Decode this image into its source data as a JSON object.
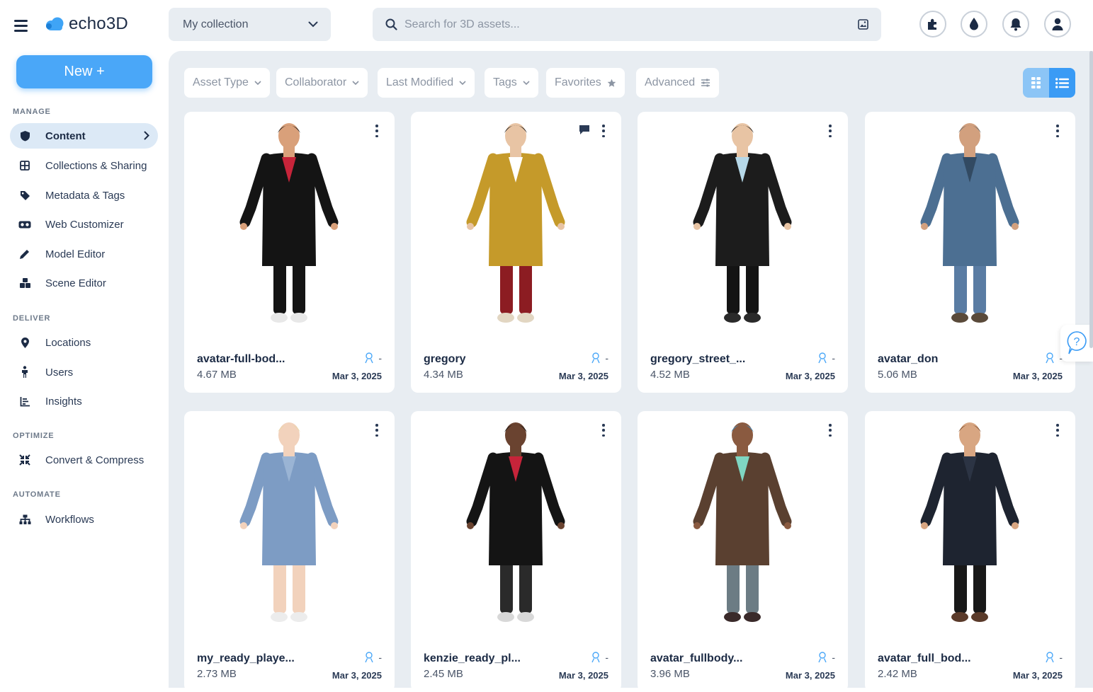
{
  "app": {
    "logo_text": "echo3D"
  },
  "header": {
    "collection": {
      "value": "My collection"
    },
    "search": {
      "placeholder": "Search for 3D assets..."
    },
    "icons": [
      "puzzle-icon",
      "drop-icon",
      "bell-icon",
      "user-icon"
    ]
  },
  "sidebar": {
    "new_button": "New +",
    "sections": [
      {
        "label": "MANAGE",
        "items": [
          {
            "label": "Content",
            "icon": "shield-icon",
            "active": true
          },
          {
            "label": "Collections & Sharing",
            "icon": "grid-icon"
          },
          {
            "label": "Metadata & Tags",
            "icon": "tag-icon"
          },
          {
            "label": "Web Customizer",
            "icon": "vr-glasses-icon"
          },
          {
            "label": "Model Editor",
            "icon": "pencil-icon"
          },
          {
            "label": "Scene Editor",
            "icon": "cubes-icon"
          }
        ]
      },
      {
        "label": "DELIVER",
        "items": [
          {
            "label": "Locations",
            "icon": "location-pin-icon"
          },
          {
            "label": "Users",
            "icon": "person-icon"
          },
          {
            "label": "Insights",
            "icon": "bar-chart-icon"
          }
        ]
      },
      {
        "label": "OPTIMIZE",
        "items": [
          {
            "label": "Convert & Compress",
            "icon": "compress-icon"
          }
        ]
      },
      {
        "label": "AUTOMATE",
        "items": [
          {
            "label": "Workflows",
            "icon": "sitemap-icon"
          }
        ]
      }
    ]
  },
  "filters": [
    {
      "label": "Asset Type",
      "icon": "chevron-down-icon"
    },
    {
      "label": "Collaborator",
      "icon": "chevron-down-icon"
    },
    {
      "label": "Last Modified",
      "icon": "chevron-down-icon"
    },
    {
      "label": "Tags",
      "icon": "chevron-down-icon"
    },
    {
      "label": "Favorites",
      "icon": "star-icon"
    },
    {
      "label": "Advanced",
      "icon": "sliders-icon"
    }
  ],
  "view_toggle": {
    "selected": "grid"
  },
  "assets": [
    {
      "name": "avatar-full-bod...",
      "size": "4.67 MB",
      "date": "Mar 3, 2025",
      "collaborators": "-",
      "has_comment": false
    },
    {
      "name": "gregory",
      "size": "4.34 MB",
      "date": "Mar 3, 2025",
      "collaborators": "-",
      "has_comment": true
    },
    {
      "name": "gregory_street_...",
      "size": "4.52 MB",
      "date": "Mar 3, 2025",
      "collaborators": "-",
      "has_comment": false
    },
    {
      "name": "avatar_don",
      "size": "5.06 MB",
      "date": "Mar 3, 2025",
      "collaborators": "-",
      "has_comment": false
    },
    {
      "name": "my_ready_playe...",
      "size": "2.73 MB",
      "date": "Mar 3, 2025",
      "collaborators": "-",
      "has_comment": false
    },
    {
      "name": "kenzie_ready_pl...",
      "size": "2.45 MB",
      "date": "Mar 3, 2025",
      "collaborators": "-",
      "has_comment": false
    },
    {
      "name": "avatar_fullbody...",
      "size": "3.96 MB",
      "date": "Mar 3, 2025",
      "collaborators": "-",
      "has_comment": false
    },
    {
      "name": "avatar_full_bod...",
      "size": "2.42 MB",
      "date": "Mar 3, 2025",
      "collaborators": "-",
      "has_comment": false
    }
  ],
  "colors": {
    "accent": "#4aa7f8",
    "background": "#e8edf2",
    "text": "#1c2b45"
  }
}
